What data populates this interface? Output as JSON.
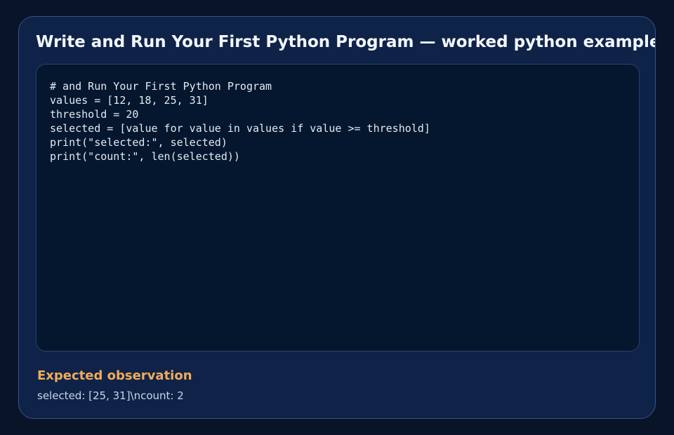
{
  "card": {
    "title": "Write and Run Your First Python Program — worked python example"
  },
  "code": {
    "lines": [
      "# and Run Your First Python Program",
      "values = [12, 18, 25, 31]",
      "threshold = 20",
      "selected = [value for value in values if value >= threshold]",
      "print(\"selected:\", selected)",
      "print(\"count:\", len(selected))"
    ]
  },
  "observation": {
    "heading": "Expected observation",
    "text": "selected: [25, 31]\\ncount: 2"
  },
  "colors": {
    "page_background": "#0a1428",
    "card_background": "#0f2349",
    "card_border": "#36538a",
    "code_background": "#04172e",
    "title_text": "#f3f6fb",
    "accent": "#f2ab58",
    "body_text": "#c9d6e8"
  }
}
